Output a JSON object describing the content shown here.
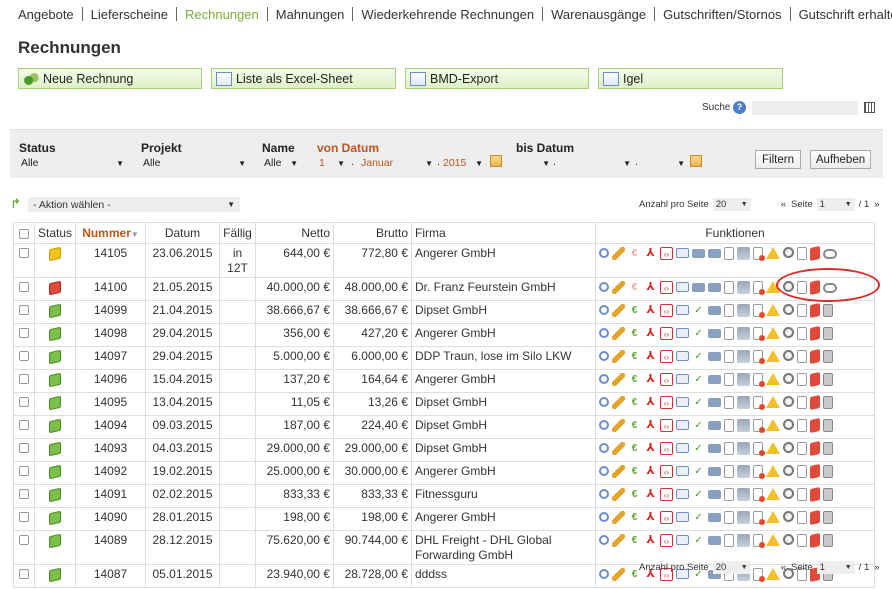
{
  "nav": {
    "items": [
      {
        "label": "Angebote",
        "active": false
      },
      {
        "label": "Lieferscheine",
        "active": false
      },
      {
        "label": "Rechnungen",
        "active": true
      },
      {
        "label": "Mahnungen",
        "active": false
      },
      {
        "label": "Wiederkehrende Rechnungen",
        "active": false
      },
      {
        "label": "Warenausgänge",
        "active": false
      },
      {
        "label": "Gutschriften/Stornos",
        "active": false
      },
      {
        "label": "Gutschrift erhalten",
        "active": false
      }
    ]
  },
  "page": {
    "title": "Rechnungen"
  },
  "toolbar": {
    "new_invoice": "Neue Rechnung",
    "excel_list": "Liste als Excel-Sheet",
    "bmd_export": "BMD-Export",
    "igel": "Igel"
  },
  "search": {
    "label": "Suche",
    "help": "?",
    "value": ""
  },
  "filters": {
    "status_label": "Status",
    "status_value": "Alle",
    "project_label": "Projekt",
    "project_value": "Alle",
    "name_label": "Name",
    "name_value": "Alle",
    "from_label": "von Datum",
    "from_day": "1",
    "from_month": "Januar",
    "from_year": "2015",
    "to_label": "bis Datum",
    "to_day": "",
    "to_month": "",
    "to_year": "",
    "filter_button": "Filtern",
    "reset_button": "Aufheben"
  },
  "actions": {
    "select": "- Aktion wählen -"
  },
  "pager": {
    "per_page_label": "Anzahl pro Seite",
    "per_page_value": "20",
    "prev": "«",
    "page_label": "Seite",
    "page_value": "1",
    "total": "/ 1",
    "next": "»"
  },
  "table": {
    "headers": {
      "status": "Status",
      "number": "Nummer",
      "date": "Datum",
      "due": "Fällig",
      "net": "Netto",
      "gross": "Brutto",
      "company": "Firma",
      "functions": "Funktionen"
    },
    "rows": [
      {
        "status": "yellow",
        "number": "14105",
        "date": "23.06.2015",
        "due": "in 12T",
        "net": "644,00 €",
        "gross": "772,80 €",
        "company": "Angerer GmbH",
        "paid": false,
        "tall": true
      },
      {
        "status": "red",
        "number": "14100",
        "date": "21.05.2015",
        "due": "",
        "net": "40.000,00 €",
        "gross": "48.000,00 €",
        "company": "Dr. Franz Feurstein GmbH",
        "paid": false,
        "tall": false
      },
      {
        "status": "green",
        "number": "14099",
        "date": "21.04.2015",
        "due": "",
        "net": "38.666,67 €",
        "gross": "38.666,67 €",
        "company": "Dipset GmbH",
        "paid": true,
        "tall": false
      },
      {
        "status": "green",
        "number": "14098",
        "date": "29.04.2015",
        "due": "",
        "net": "356,00 €",
        "gross": "427,20 €",
        "company": "Angerer GmbH",
        "paid": true,
        "tall": false
      },
      {
        "status": "green",
        "number": "14097",
        "date": "29.04.2015",
        "due": "",
        "net": "5.000,00 €",
        "gross": "6.000,00 €",
        "company": "DDP Traun, lose im Silo LKW",
        "paid": true,
        "tall": false
      },
      {
        "status": "green",
        "number": "14096",
        "date": "15.04.2015",
        "due": "",
        "net": "137,20 €",
        "gross": "164,64 €",
        "company": "Angerer GmbH",
        "paid": true,
        "tall": false
      },
      {
        "status": "green",
        "number": "14095",
        "date": "13.04.2015",
        "due": "",
        "net": "11,05 €",
        "gross": "13,26 €",
        "company": "Dipset GmbH",
        "paid": true,
        "tall": false
      },
      {
        "status": "green",
        "number": "14094",
        "date": "09.03.2015",
        "due": "",
        "net": "187,00 €",
        "gross": "224,40 €",
        "company": "Dipset GmbH",
        "paid": true,
        "tall": false
      },
      {
        "status": "green",
        "number": "14093",
        "date": "04.03.2015",
        "due": "",
        "net": "29.000,00 €",
        "gross": "29.000,00 €",
        "company": "Dipset GmbH",
        "paid": true,
        "tall": false
      },
      {
        "status": "green",
        "number": "14092",
        "date": "19.02.2015",
        "due": "",
        "net": "25.000,00 €",
        "gross": "30.000,00 €",
        "company": "Angerer GmbH",
        "paid": true,
        "tall": false
      },
      {
        "status": "green",
        "number": "14091",
        "date": "02.02.2015",
        "due": "",
        "net": "833,33 €",
        "gross": "833,33 €",
        "company": "Fitnessguru",
        "paid": true,
        "tall": false
      },
      {
        "status": "green",
        "number": "14090",
        "date": "28.01.2015",
        "due": "",
        "net": "198,00 €",
        "gross": "198,00 €",
        "company": "Angerer GmbH",
        "paid": true,
        "tall": false
      },
      {
        "status": "green",
        "number": "14089",
        "date": "28.12.2015",
        "due": "",
        "net": "75.620,00 €",
        "gross": "90.744,00 €",
        "company": "DHL Freight - DHL Global Forwarding GmbH",
        "paid": true,
        "tall": true
      },
      {
        "status": "green",
        "number": "14087",
        "date": "05.01.2015",
        "due": "",
        "net": "23.940,00 €",
        "gross": "28.728,00 €",
        "company": "dddss",
        "paid": true,
        "tall": false
      }
    ]
  },
  "colors": {
    "accent_green": "#7aae3a",
    "sort_orange": "#b8561e",
    "highlight_red": "#e02a2a"
  }
}
